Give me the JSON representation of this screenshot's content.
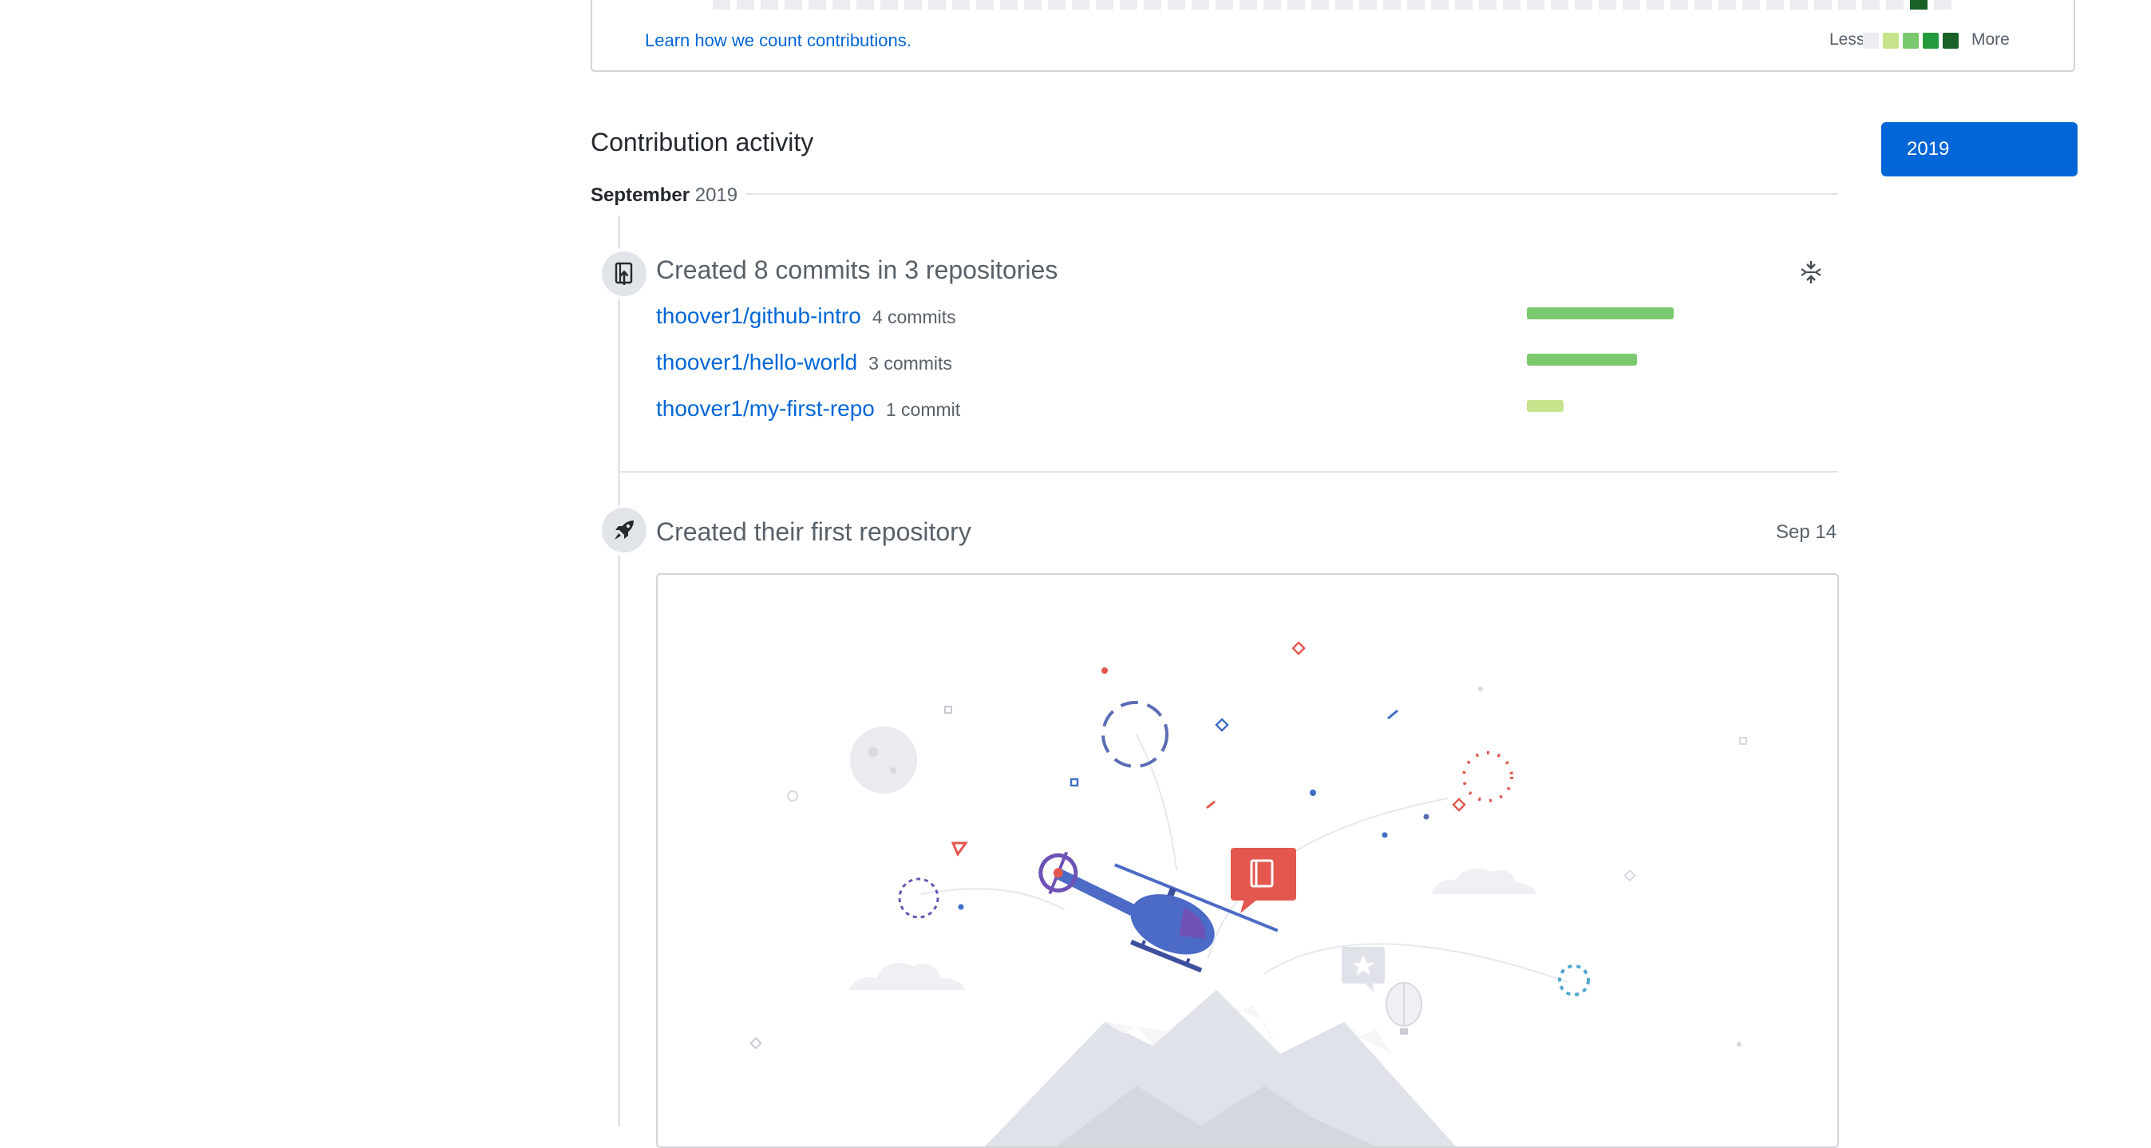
{
  "graph": {
    "learn_link": "Learn how we count contributions.",
    "legend_less": "Less",
    "legend_more": "More",
    "legend_colors": [
      "#ebedf0",
      "#c6e48b",
      "#7bc96f",
      "#239a3b",
      "#196127"
    ]
  },
  "activity": {
    "title": "Contribution activity",
    "year_button": "2019",
    "month": "September",
    "year": "2019"
  },
  "commits_entry": {
    "title": "Created 8 commits in 3 repositories",
    "icon": "repo-push-icon",
    "menu_icon": "fold-icon",
    "repos": [
      {
        "name": "thoover1/github-intro",
        "count": "4 commits",
        "share": 1.0,
        "color": "#7bc96f"
      },
      {
        "name": "thoover1/hello-world",
        "count": "3 commits",
        "share": 0.75,
        "color": "#7bc96f"
      },
      {
        "name": "thoover1/my-first-repo",
        "count": "1 commit",
        "share": 0.25,
        "color": "#c6e48b"
      }
    ]
  },
  "first_repo_entry": {
    "title": "Created their first repository",
    "date": "Sep 14",
    "icon": "rocket-icon",
    "illustration": "helicopter-illustration"
  }
}
